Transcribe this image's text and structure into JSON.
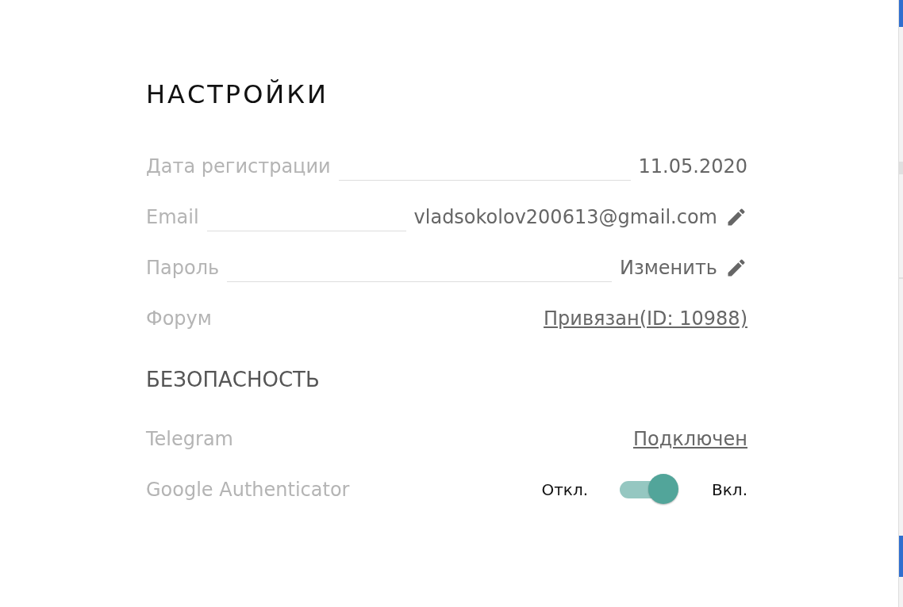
{
  "title": "НАСТРОЙКИ",
  "account_rows": [
    {
      "label": "Дата регистрации",
      "value": "11.05.2020",
      "kind": "text"
    },
    {
      "label": "Email",
      "value": "vladsokolov200613@gmail.com",
      "kind": "editable"
    },
    {
      "label": "Пароль",
      "value": "Изменить",
      "kind": "editable"
    },
    {
      "label": "Форум",
      "value": "Привязан(ID: 10988)",
      "kind": "link"
    }
  ],
  "security": {
    "heading": "БЕЗОПАСНОСТЬ",
    "telegram": {
      "label": "Telegram",
      "value": "Подключен"
    },
    "authenticator": {
      "label": "Google Authenticator",
      "off_label": "Откл.",
      "on_label": "Вкл.",
      "on": true
    }
  }
}
